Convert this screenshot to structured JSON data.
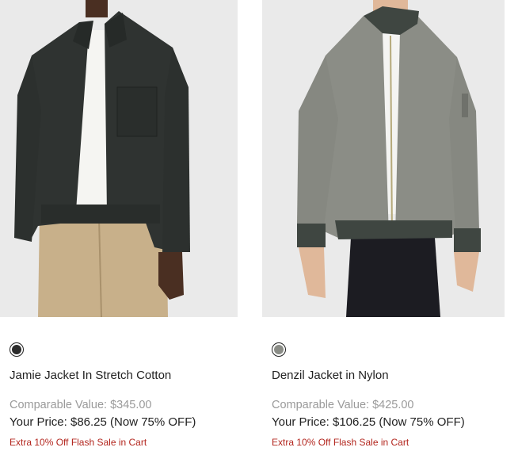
{
  "products": [
    {
      "name": "Jamie Jacket In Stretch Cotton",
      "swatch_color": "#2b2b2b",
      "comparable": "Comparable Value: $345.00",
      "price": "Your Price: $86.25 (Now 75% OFF)",
      "promo": "Extra 10% Off Flash Sale in Cart"
    },
    {
      "name": "Denzil Jacket in Nylon",
      "swatch_color": "#8a8c86",
      "comparable": "Comparable Value: $425.00",
      "price": "Your Price: $106.25 (Now 75% OFF)",
      "promo": "Extra 10% Off Flash Sale in Cart"
    }
  ]
}
